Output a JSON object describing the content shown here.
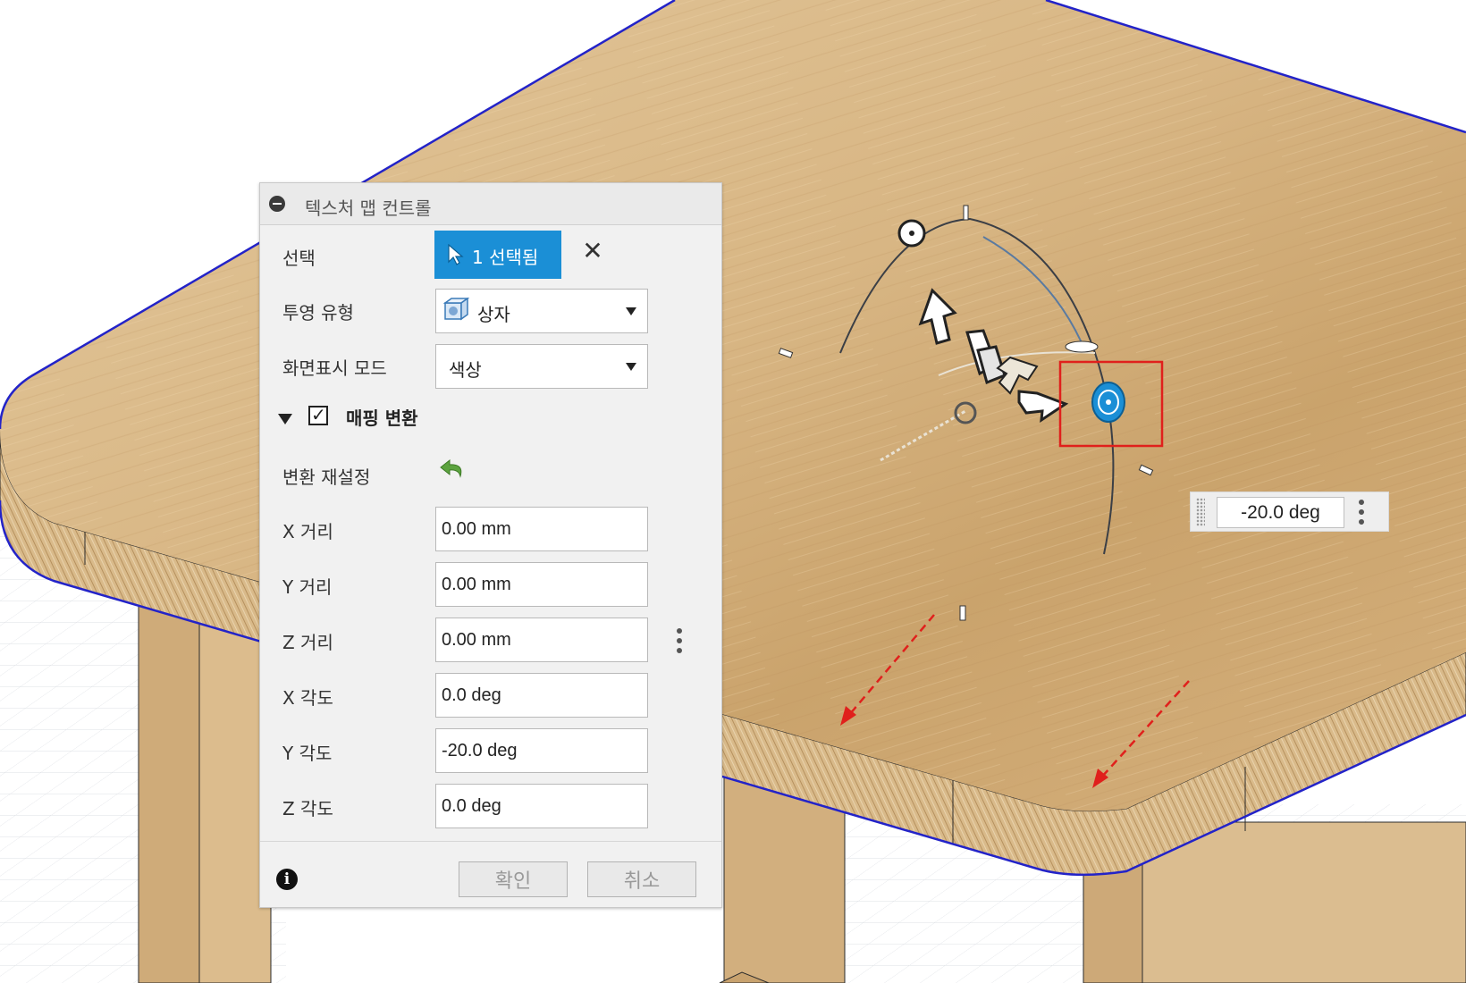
{
  "panel": {
    "title": "텍스처 맵 컨트롤",
    "selection": {
      "label": "선택",
      "button": "1 선택됨"
    },
    "projection": {
      "label": "투영 유형",
      "value": "상자"
    },
    "display_mode": {
      "label": "화면표시 모드",
      "value": "색상"
    },
    "mapping": {
      "title": "매핑 변환",
      "checked": true,
      "reset_label": "변환 재설정",
      "x_distance": {
        "label": "X 거리",
        "value": "0.00 mm"
      },
      "y_distance": {
        "label": "Y 거리",
        "value": "0.00 mm"
      },
      "z_distance": {
        "label": "Z 거리",
        "value": "0.00 mm"
      },
      "x_angle": {
        "label": "X 각도",
        "value": "0.0 deg"
      },
      "y_angle": {
        "label": "Y 각도",
        "value": "-20.0 deg"
      },
      "z_angle": {
        "label": "Z 각도",
        "value": "0.0 deg"
      }
    },
    "footer": {
      "ok": "확인",
      "cancel": "취소"
    }
  },
  "viewport": {
    "angle_input": "-20.0 deg",
    "colors": {
      "wood_light": "#dcbb8a",
      "wood_dark": "#c49a63",
      "edge_highlight": "#2323c8",
      "manipulator_blue": "#1b8fd6",
      "annotation_red": "#e0201c"
    }
  }
}
